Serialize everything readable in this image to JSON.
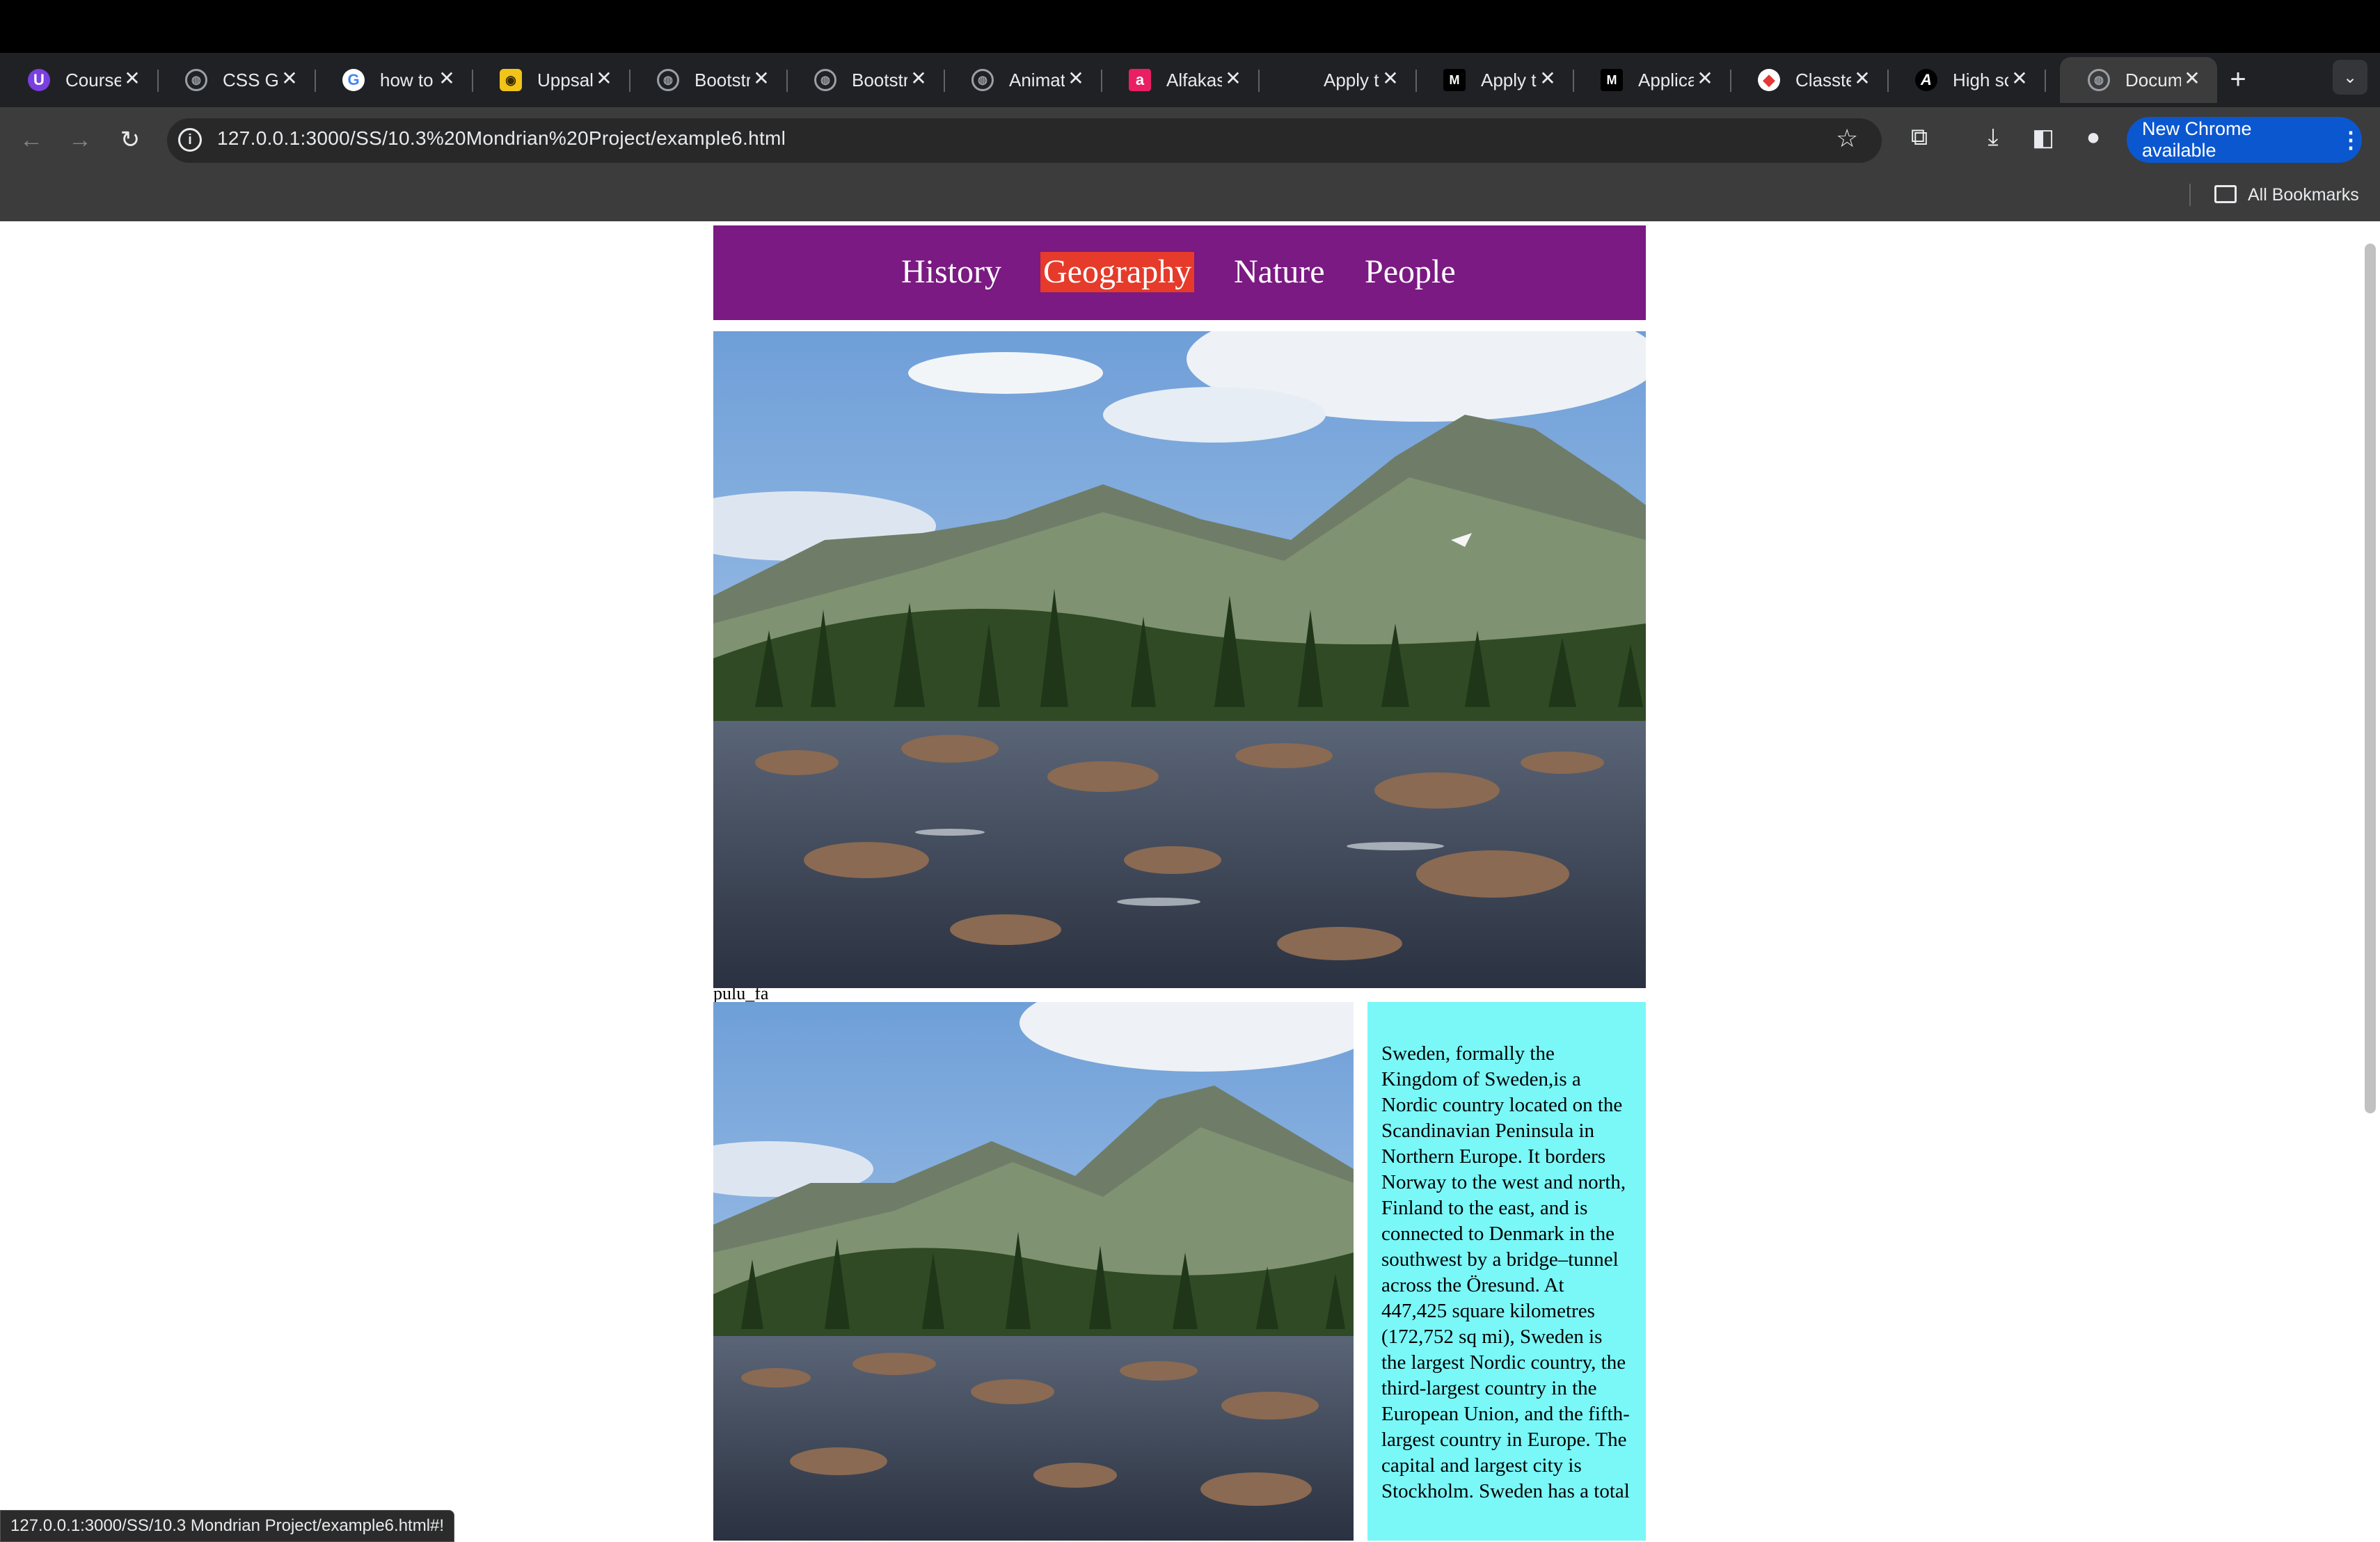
{
  "browser": {
    "tabs": [
      {
        "title": "Course",
        "favicon": "course-icon",
        "color": "#7a3fe0",
        "glyph": "U"
      },
      {
        "title": "CSS Gr",
        "favicon": "globe-icon",
        "color": "#5f6368",
        "glyph": "◍"
      },
      {
        "title": "how to",
        "favicon": "google-icon",
        "color": "#ffffff",
        "glyph": "G"
      },
      {
        "title": "Uppsal",
        "favicon": "uppsala-icon",
        "color": "#f0c419",
        "glyph": "◉"
      },
      {
        "title": "Bootstr",
        "favicon": "globe-icon",
        "color": "#5f6368",
        "glyph": "◍"
      },
      {
        "title": "Bootstr",
        "favicon": "globe-icon",
        "color": "#5f6368",
        "glyph": "◍"
      },
      {
        "title": "Animat",
        "favicon": "globe-icon",
        "color": "#5f6368",
        "glyph": "◍"
      },
      {
        "title": "Alfakas",
        "favicon": "alfakassa-icon",
        "color": "#e91e63",
        "glyph": "a"
      },
      {
        "title": "Apply t",
        "favicon": "",
        "color": "#202124",
        "glyph": ""
      },
      {
        "title": "Apply t",
        "favicon": "medium-icon",
        "color": "#000000",
        "glyph": "M"
      },
      {
        "title": "Applica",
        "favicon": "medium-icon",
        "color": "#000000",
        "glyph": "M"
      },
      {
        "title": "Classte",
        "favicon": "classtime-icon",
        "color": "#e53935",
        "glyph": "◆"
      },
      {
        "title": "High sc",
        "favicon": "academy-icon",
        "color": "#000000",
        "glyph": "A"
      },
      {
        "title": "Docum",
        "favicon": "globe-icon",
        "color": "#5f6368",
        "glyph": "◍"
      }
    ],
    "url": "127.0.0.1:3000/SS/10.3%20Mondrian%20Project/example6.html",
    "update_button": "New Chrome available",
    "bookmarks_label": "All Bookmarks",
    "status_url": "127.0.0.1:3000/SS/10.3 Mondrian Project/example6.html#!"
  },
  "site": {
    "nav": [
      {
        "label": "History"
      },
      {
        "label": "Geography",
        "active": true
      },
      {
        "label": "Nature"
      },
      {
        "label": "People"
      }
    ],
    "stray_text": "pulu_fa",
    "info_text": "Sweden, formally the Kingdom of Sweden,is a Nordic country located on the Scandinavian Peninsula in Northern Europe. It borders Norway to the west and north, Finland to the east, and is connected to Denmark in the southwest by a bridge–tunnel across the Öresund. At 447,425 square kilometres (172,752 sq mi), Sweden is the largest Nordic country, the third-largest country in the European Union, and the fifth-largest country in Europe. The capital and largest city is Stockholm. Sweden has a total",
    "colors": {
      "nav_bg": "#7a1a82",
      "active_link": "#e63a2a",
      "info_bg": "#7af7f7"
    }
  }
}
